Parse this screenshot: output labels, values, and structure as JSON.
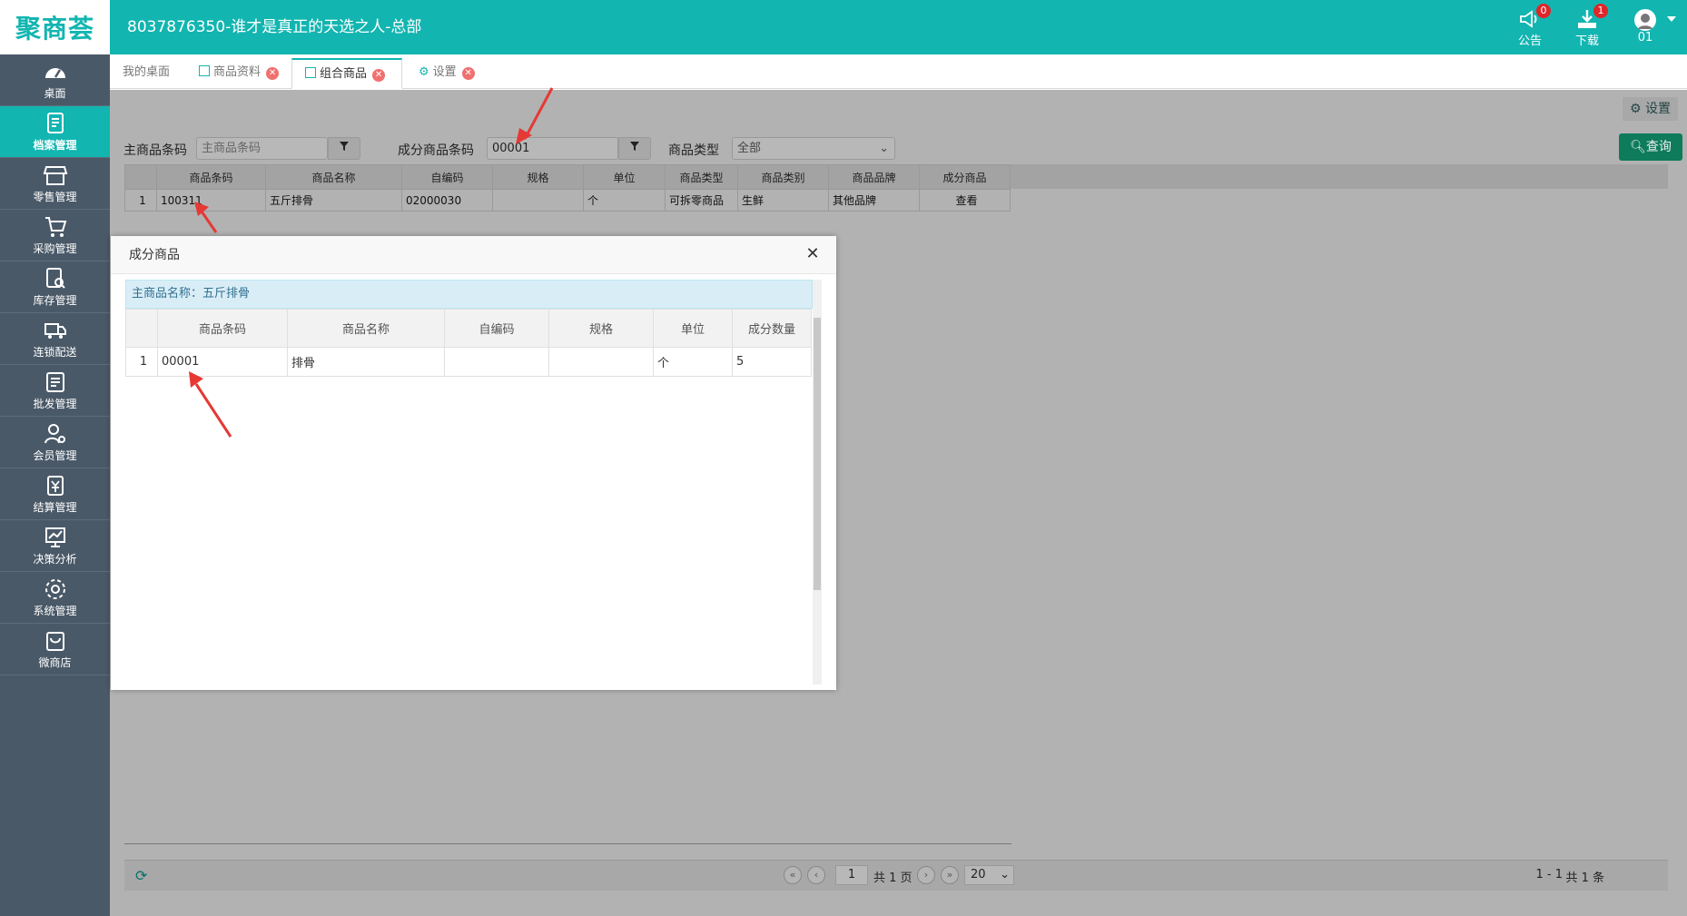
{
  "header": {
    "logo": "聚商荟",
    "title": "8037876350-谁才是真正的天选之人-总部",
    "notice_label": "公告",
    "notice_count": "0",
    "download_label": "下载",
    "download_count": "1",
    "user_label": "01"
  },
  "sidebar": {
    "items": [
      {
        "label": "桌面",
        "icon": "dashboard-icon"
      },
      {
        "label": "档案管理",
        "icon": "archive-icon"
      },
      {
        "label": "零售管理",
        "icon": "store-icon"
      },
      {
        "label": "采购管理",
        "icon": "cart-icon"
      },
      {
        "label": "库存管理",
        "icon": "inventory-icon"
      },
      {
        "label": "连锁配送",
        "icon": "truck-icon"
      },
      {
        "label": "批发管理",
        "icon": "wholesale-icon"
      },
      {
        "label": "会员管理",
        "icon": "member-icon"
      },
      {
        "label": "结算管理",
        "icon": "settlement-icon"
      },
      {
        "label": "决策分析",
        "icon": "chart-icon"
      },
      {
        "label": "系统管理",
        "icon": "gear-icon"
      },
      {
        "label": "微商店",
        "icon": "bag-icon"
      }
    ],
    "active_index": 1
  },
  "tabs": [
    {
      "label": "我的桌面"
    },
    {
      "label": "商品资料"
    },
    {
      "label": "组合商品"
    },
    {
      "label": "设置"
    }
  ],
  "toolbar": {
    "settings_label": "设置",
    "query_label": "查询"
  },
  "search": {
    "main_code_label": "主商品条码",
    "main_code_placeholder": "主商品条码",
    "component_code_label": "成分商品条码",
    "component_code_value": "00001",
    "type_label": "商品类型",
    "type_value": "全部"
  },
  "main_table": {
    "headers": [
      "",
      "商品条码",
      "商品名称",
      "自编码",
      "规格",
      "单位",
      "商品类型",
      "商品类别",
      "商品品牌",
      "成分商品"
    ],
    "rows": [
      [
        "1",
        "100311",
        "五斤排骨",
        "02000030",
        "",
        "个",
        "可拆零商品",
        "生鲜",
        "其他品牌",
        "查看"
      ]
    ]
  },
  "pager": {
    "page": "1",
    "total_pages": "共 1 页",
    "page_size": "20",
    "range": "1 - 1",
    "total": "共 1 条"
  },
  "modal": {
    "title": "成分商品",
    "caption": "主商品名称：五斤排骨",
    "headers": [
      "",
      "商品条码",
      "商品名称",
      "自编码",
      "规格",
      "单位",
      "成分数量"
    ],
    "rows": [
      [
        "1",
        "00001",
        "排骨",
        "",
        "",
        "个",
        "5"
      ]
    ]
  },
  "colors": {
    "brand": "#12b5b0",
    "sidebar": "#4a5968",
    "badge": "#e0262a",
    "arrow": "#e53935"
  }
}
